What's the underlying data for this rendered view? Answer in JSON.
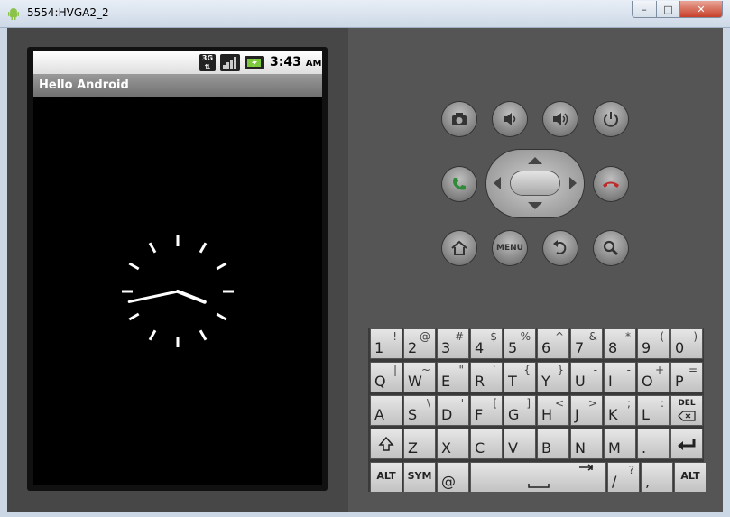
{
  "window": {
    "title": "5554:HVGA2_2",
    "min_label": "–",
    "max_label": "□",
    "close_label": "✕"
  },
  "statusbar": {
    "network": "3G",
    "time": "3:43",
    "ampm": "AM"
  },
  "app": {
    "title": "Hello Android"
  },
  "clock": {
    "hours": 3,
    "minutes": 43
  },
  "hardware_buttons": {
    "menu_label": "MENU"
  },
  "colors": {
    "call_green": "#2f8a3a",
    "end_red": "#c0282a",
    "skin": "#555555"
  },
  "keyboard": {
    "rows": [
      [
        {
          "m": "1",
          "a": "!"
        },
        {
          "m": "2",
          "a": "@"
        },
        {
          "m": "3",
          "a": "#"
        },
        {
          "m": "4",
          "a": "$"
        },
        {
          "m": "5",
          "a": "%"
        },
        {
          "m": "6",
          "a": "^"
        },
        {
          "m": "7",
          "a": "&"
        },
        {
          "m": "8",
          "a": "*"
        },
        {
          "m": "9",
          "a": "("
        },
        {
          "m": "0",
          "a": ")"
        }
      ],
      [
        {
          "m": "Q",
          "a": "|"
        },
        {
          "m": "W",
          "a": "~"
        },
        {
          "m": "E",
          "a": "\""
        },
        {
          "m": "R",
          "a": "`"
        },
        {
          "m": "T",
          "a": "{"
        },
        {
          "m": "Y",
          "a": "}"
        },
        {
          "m": "U",
          "a": "-"
        },
        {
          "m": "I",
          "a": "-"
        },
        {
          "m": "O",
          "a": "+"
        },
        {
          "m": "P",
          "a": "="
        }
      ],
      [
        {
          "m": "A",
          "a": ""
        },
        {
          "m": "S",
          "a": "\\"
        },
        {
          "m": "D",
          "a": "'"
        },
        {
          "m": "F",
          "a": "["
        },
        {
          "m": "G",
          "a": "]"
        },
        {
          "m": "H",
          "a": "<"
        },
        {
          "m": "J",
          "a": ">"
        },
        {
          "m": "K",
          "a": ";"
        },
        {
          "m": "L",
          "a": ":"
        },
        {
          "m": "DEL",
          "a": "",
          "special": "del"
        }
      ],
      [
        {
          "m": "",
          "a": "",
          "special": "shift"
        },
        {
          "m": "Z",
          "a": ""
        },
        {
          "m": "X",
          "a": ""
        },
        {
          "m": "C",
          "a": ""
        },
        {
          "m": "V",
          "a": ""
        },
        {
          "m": "B",
          "a": ""
        },
        {
          "m": "N",
          "a": ""
        },
        {
          "m": "M",
          "a": ""
        },
        {
          "m": ".",
          "a": ""
        },
        {
          "m": "",
          "a": "",
          "special": "enter"
        }
      ],
      [
        {
          "m": "ALT",
          "a": "",
          "special": "label"
        },
        {
          "m": "SYM",
          "a": "",
          "special": "label"
        },
        {
          "m": "@",
          "a": ""
        },
        {
          "m": "",
          "a": "",
          "special": "space"
        },
        {
          "m": "/",
          "a": "?"
        },
        {
          "m": ",",
          "a": ""
        },
        {
          "m": "ALT",
          "a": "",
          "special": "label"
        }
      ]
    ]
  }
}
